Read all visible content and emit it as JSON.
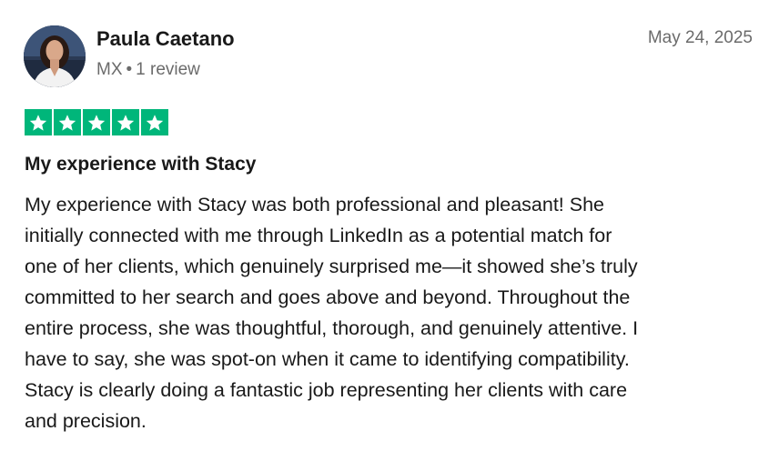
{
  "reviewer": {
    "name": "Paula Caetano",
    "country": "MX",
    "separator": "•",
    "review_count": "1 review"
  },
  "review": {
    "date": "May 24, 2025",
    "rating": 5,
    "max_rating": 5,
    "star_color": "#00b67a",
    "title": "My experience with Stacy",
    "body_lines": [
      "My experience with Stacy was both professional and pleasant! She",
      "initially connected with me through LinkedIn as a potential match for",
      "one of her clients, which genuinely surprised me—it showed she’s truly",
      "committed to her search and goes above and beyond. Throughout the",
      "entire process, she was thoughtful, thorough, and genuinely attentive. I",
      "have to say, she was spot-on when it came to identifying compatibility.",
      "Stacy is clearly doing a fantastic job representing her clients with care",
      "and precision."
    ]
  },
  "icons": {
    "avatar": "profile-photo",
    "star": "star-icon"
  }
}
